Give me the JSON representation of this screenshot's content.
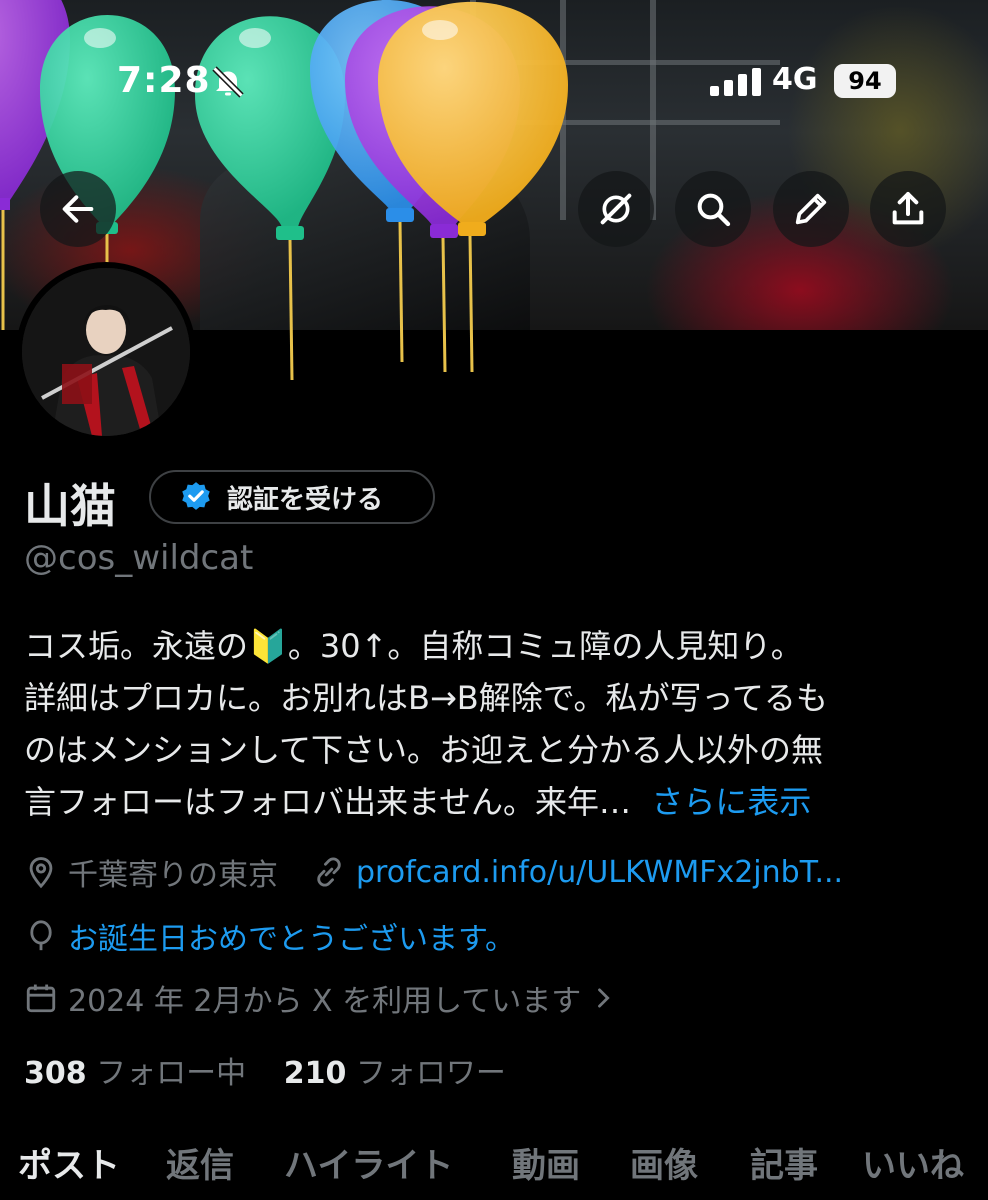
{
  "status_bar": {
    "time": "7:28",
    "network": "4G",
    "battery": "94"
  },
  "nav": {
    "icons": [
      "back-arrow-icon",
      "grok-icon",
      "search-icon",
      "edit-pencil-icon",
      "share-icon"
    ]
  },
  "profile": {
    "name": "山猫",
    "verify_label": "認証を受ける",
    "handle": "@cos_wildcat",
    "bio_lines": [
      "コス垢。永遠の🔰。30↑。自称コミュ障の人見知り。",
      "詳細はプロカに。お別れはB→B解除で。私が写ってるも",
      "のはメンションして下さい。お迎えと分かる人以外の無",
      "言フォローはフォロバ出来ません。来年…"
    ],
    "show_more": "さらに表示",
    "location": "千葉寄りの東京",
    "url": "profcard.info/u/ULKWMFx2jnbT...",
    "birthday": "お誕生日おめでとうございます。",
    "joined": "2024 年 2月から X を利用しています",
    "following_count": "308",
    "following_label": "フォロー中",
    "followers_count": "210",
    "followers_label": "フォロワー"
  },
  "tabs": [
    "ポスト",
    "返信",
    "ハイライト",
    "動画",
    "画像",
    "記事",
    "いいね"
  ],
  "colors": {
    "accent": "#1d9bf0",
    "muted": "#71767b",
    "text": "#e7e9ea",
    "background": "#000000"
  }
}
